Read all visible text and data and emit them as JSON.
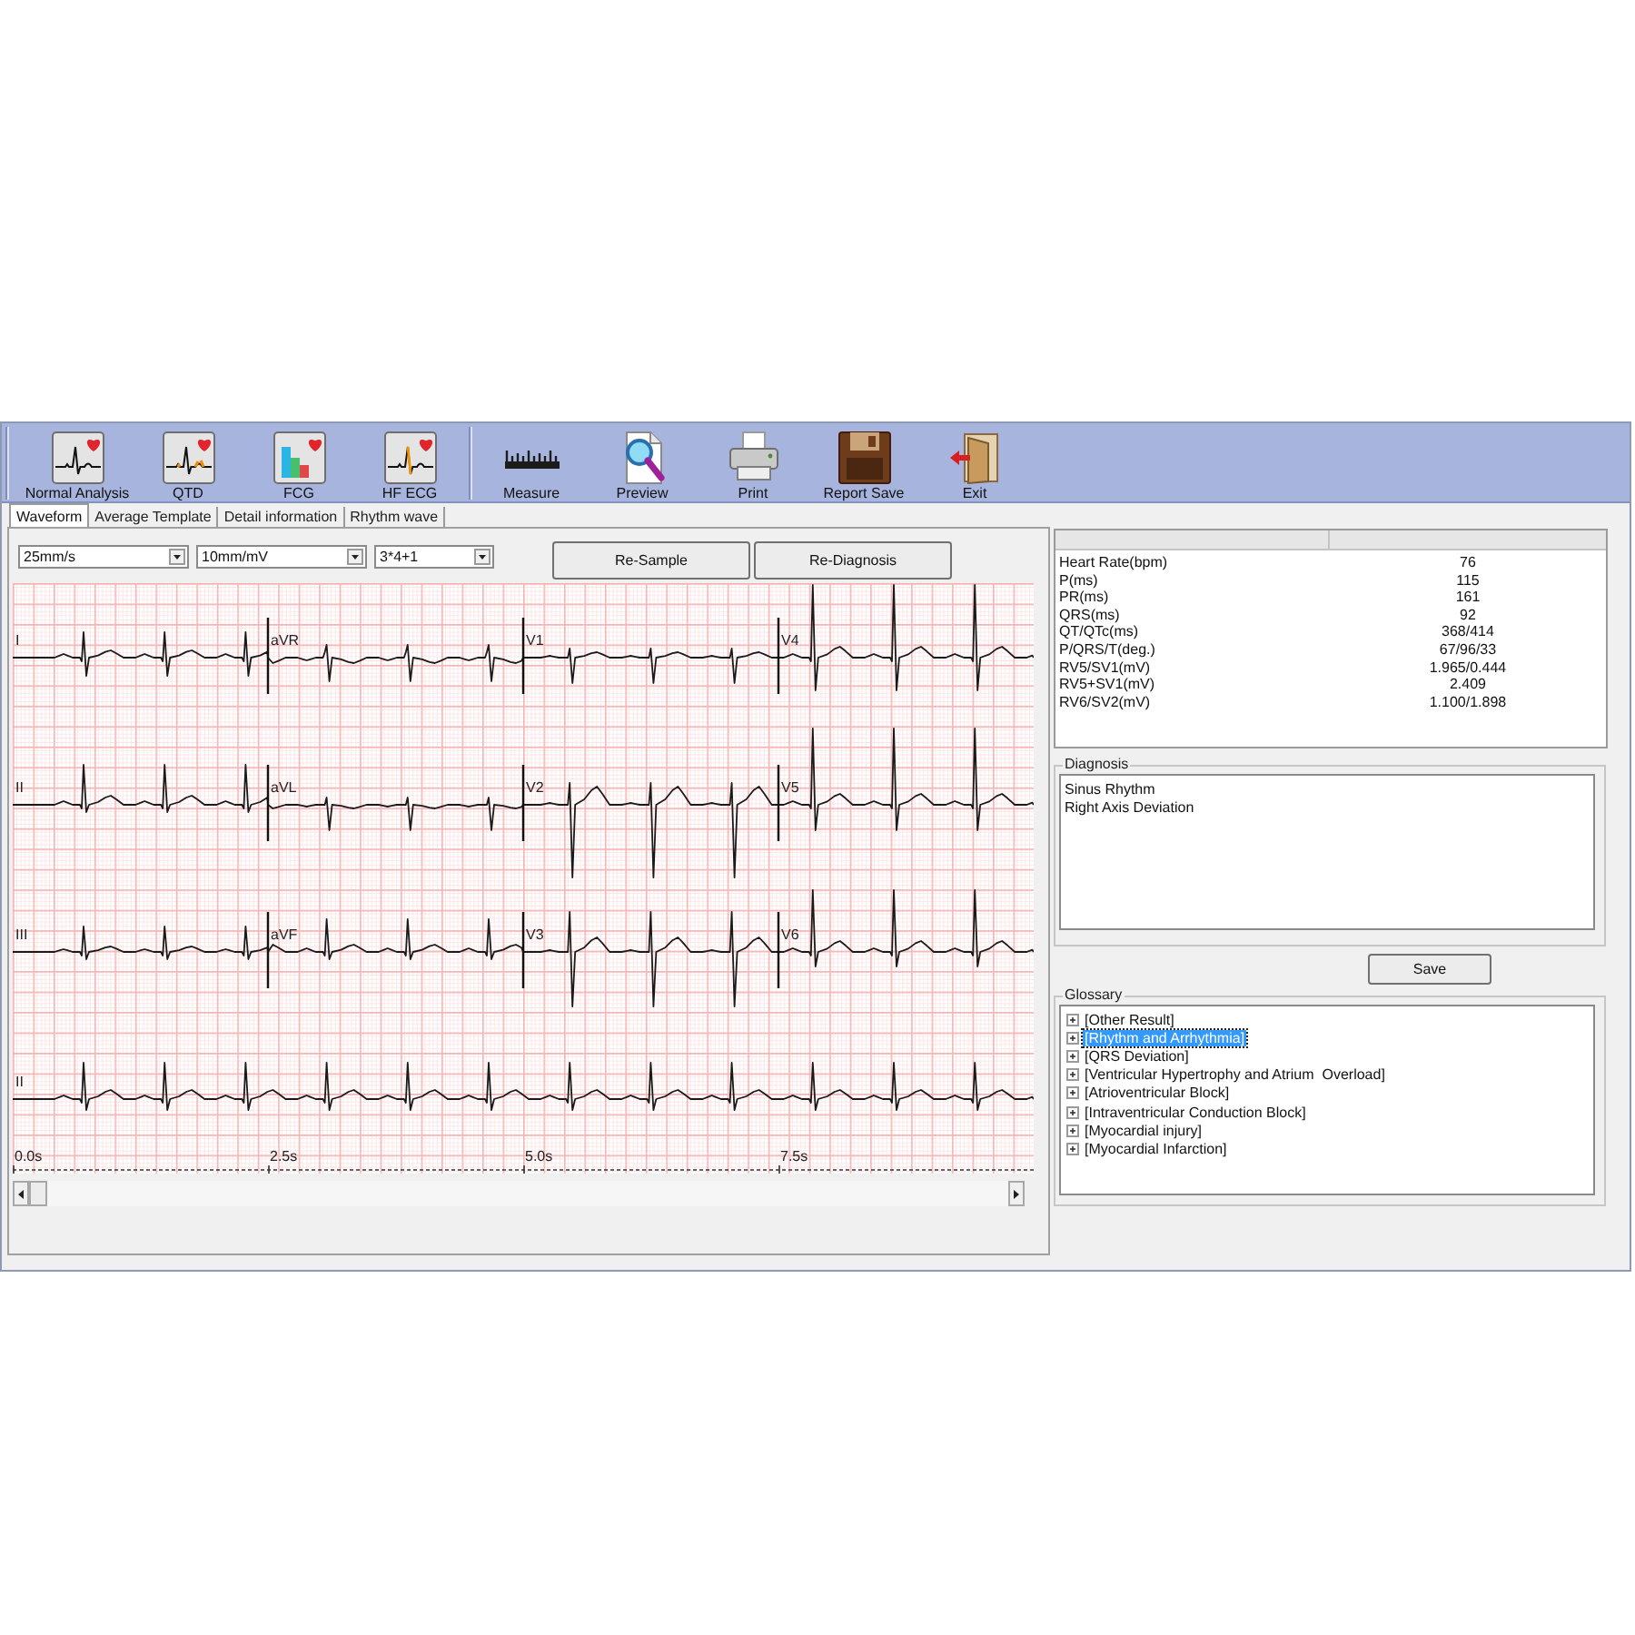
{
  "toolbar": {
    "groups": [
      [
        "Normal Analysis",
        "QTD",
        "FCG",
        "HF ECG"
      ],
      [
        "Measure",
        "Preview",
        "Print",
        "Report Save",
        "Exit"
      ]
    ]
  },
  "tabs": [
    {
      "label": "Waveform",
      "selected": true
    },
    {
      "label": "Average Template",
      "selected": false
    },
    {
      "label": "Detail information",
      "selected": false
    },
    {
      "label": "Rhythm wave",
      "selected": false
    }
  ],
  "waveform": {
    "dropdowns": [
      {
        "value": "25mm/s"
      },
      {
        "value": "10mm/mV"
      },
      {
        "value": "3*4+1"
      }
    ],
    "buttons": [
      "Re-Sample",
      "Re-Diagnosis"
    ],
    "lead_rows": [
      [
        "I",
        "aVR",
        "V1",
        "V4"
      ],
      [
        "II",
        "aVL",
        "V2",
        "V5"
      ],
      [
        "III",
        "aVF",
        "V3",
        "V6"
      ],
      [
        "II"
      ]
    ],
    "time_labels": [
      "0.0s",
      "2.5s",
      "5.0s",
      "7.5s"
    ]
  },
  "measurements": {
    "rows": [
      {
        "label": "Heart Rate(bpm)",
        "value": "76"
      },
      {
        "label": "P(ms)",
        "value": "115"
      },
      {
        "label": "PR(ms)",
        "value": "161"
      },
      {
        "label": "QRS(ms)",
        "value": "92"
      },
      {
        "label": "QT/QTc(ms)",
        "value": "368/414"
      },
      {
        "label": "P/QRS/T(deg.)",
        "value": "67/96/33"
      },
      {
        "label": "RV5/SV1(mV)",
        "value": "1.965/0.444"
      },
      {
        "label": "RV5+SV1(mV)",
        "value": "2.409"
      },
      {
        "label": "RV6/SV2(mV)",
        "value": "1.100/1.898"
      }
    ]
  },
  "diagnosis": {
    "title": "Diagnosis",
    "lines": [
      "Sinus Rhythm",
      "Right Axis Deviation"
    ]
  },
  "save_button": "Save",
  "glossary": {
    "title": "Glossary",
    "items": [
      {
        "label": "[Other Result]",
        "selected": false,
        "expanded": false
      },
      {
        "label": "[Rhythm and Arrhythmia]",
        "selected": true,
        "expanded": false
      },
      {
        "label": "[QRS Deviation]",
        "selected": false,
        "expanded": false
      },
      {
        "label": "[Ventricular Hypertrophy and Atrium  Overload]",
        "selected": false,
        "expanded": false
      },
      {
        "label": "[Atrioventricular Block]",
        "selected": false,
        "expanded": false
      },
      {
        "label": "[Intraventricular Conduction Block]",
        "selected": false,
        "expanded": false
      },
      {
        "label": "[Myocardial injury]",
        "selected": false,
        "expanded": false
      },
      {
        "label": "[Myocardial Infarction]",
        "selected": false,
        "expanded": false
      }
    ]
  }
}
